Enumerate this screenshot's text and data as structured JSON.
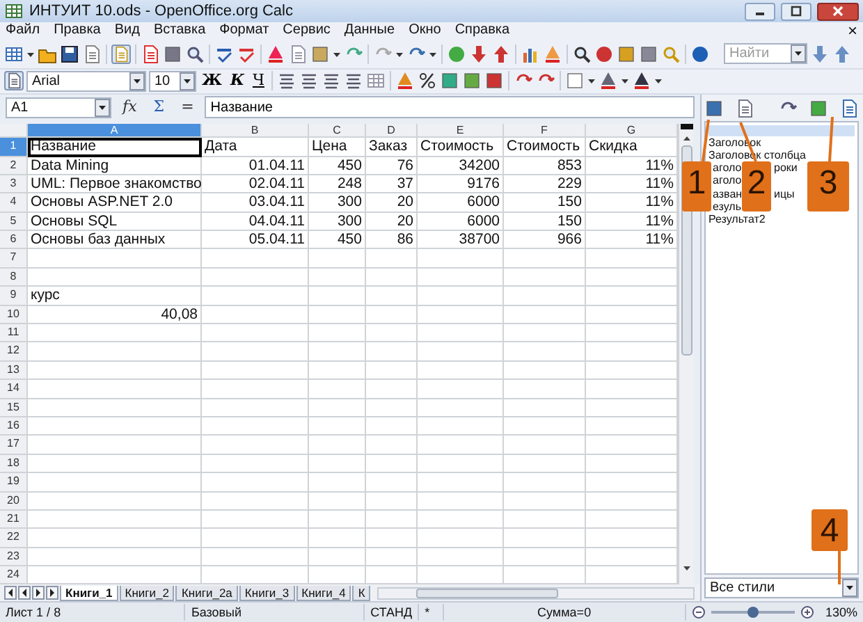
{
  "window": {
    "title": "ИНТУИТ 10.ods - OpenOffice.org Calc"
  },
  "menu": {
    "items": [
      "Файл",
      "Правка",
      "Вид",
      "Вставка",
      "Формат",
      "Сервис",
      "Данные",
      "Окно",
      "Справка"
    ],
    "close": "×"
  },
  "search": {
    "placeholder": "Найти"
  },
  "font": {
    "name": "Arial",
    "size": "10"
  },
  "format_buttons": [
    "Ж",
    "К",
    "Ч"
  ],
  "formula_bar": {
    "cell": "A1",
    "buttons": [
      "fx",
      "Σ",
      "="
    ],
    "content": "Название"
  },
  "columns": [
    {
      "label": "A",
      "selected": true
    },
    {
      "label": "B",
      "selected": false
    },
    {
      "label": "C",
      "selected": false
    },
    {
      "label": "D",
      "selected": false
    },
    {
      "label": "E",
      "selected": false
    },
    {
      "label": "F",
      "selected": false
    },
    {
      "label": "G",
      "selected": false
    }
  ],
  "rows": [
    {
      "number": "1",
      "selected": true,
      "kind": "header",
      "cells": [
        "Название",
        "Дата",
        "Цена",
        "Заказ",
        "Стоимость",
        "Стоимость",
        "Скидка"
      ]
    },
    {
      "number": "2",
      "selected": false,
      "kind": "data",
      "cells": [
        "Data Mining",
        "01.04.11",
        "450",
        "76",
        "34200",
        "853",
        "11%"
      ]
    },
    {
      "number": "3",
      "selected": false,
      "kind": "data",
      "cells": [
        "UML: Первое знакомство",
        "02.04.11",
        "248",
        "37",
        "9176",
        "229",
        "11%"
      ]
    },
    {
      "number": "4",
      "selected": false,
      "kind": "data",
      "cells": [
        "Основы ASP.NET 2.0",
        "03.04.11",
        "300",
        "20",
        "6000",
        "150",
        "11%"
      ]
    },
    {
      "number": "5",
      "selected": false,
      "kind": "data",
      "cells": [
        "Основы SQL",
        "04.04.11",
        "300",
        "20",
        "6000",
        "150",
        "11%"
      ]
    },
    {
      "number": "6",
      "selected": false,
      "kind": "data",
      "cells": [
        "Основы баз данных",
        "05.04.11",
        "450",
        "86",
        "38700",
        "966",
        "11%"
      ]
    },
    {
      "number": "7",
      "selected": false,
      "kind": "empty"
    },
    {
      "number": "8",
      "selected": false,
      "kind": "empty"
    },
    {
      "number": "9",
      "selected": false,
      "kind": "label",
      "cells": [
        "курс"
      ]
    },
    {
      "number": "10",
      "selected": false,
      "kind": "value",
      "cells": [
        "40,08"
      ]
    },
    {
      "number": "11",
      "selected": false,
      "kind": "empty"
    },
    {
      "number": "12",
      "selected": false,
      "kind": "empty"
    },
    {
      "number": "13",
      "selected": false,
      "kind": "empty"
    },
    {
      "number": "14",
      "selected": false,
      "kind": "empty"
    },
    {
      "number": "15",
      "selected": false,
      "kind": "empty"
    },
    {
      "number": "16",
      "selected": false,
      "kind": "empty"
    },
    {
      "number": "17",
      "selected": false,
      "kind": "empty"
    },
    {
      "number": "18",
      "selected": false,
      "kind": "empty"
    },
    {
      "number": "19",
      "selected": false,
      "kind": "empty"
    },
    {
      "number": "20",
      "selected": false,
      "kind": "empty"
    },
    {
      "number": "21",
      "selected": false,
      "kind": "empty"
    },
    {
      "number": "22",
      "selected": false,
      "kind": "empty"
    },
    {
      "number": "23",
      "selected": false,
      "kind": "empty"
    },
    {
      "number": "24",
      "selected": false,
      "kind": "empty"
    }
  ],
  "sheet_tabs": [
    {
      "label": "Книги_1",
      "selected": true
    },
    {
      "label": "Книги_2",
      "selected": false
    },
    {
      "label": "Книги_2a",
      "selected": false
    },
    {
      "label": "Книги_3",
      "selected": false
    },
    {
      "label": "Книги_4",
      "selected": false
    },
    {
      "label": "К",
      "selected": false
    }
  ],
  "styles_panel": {
    "items": [
      {
        "kind": "plain",
        "parts": [
          "Заголовок"
        ]
      },
      {
        "kind": "plain",
        "parts": [
          "Заголовок столбца"
        ]
      },
      {
        "kind": "fragment",
        "parts": [
          "аголо",
          "роки"
        ]
      },
      {
        "kind": "fragment",
        "parts": [
          "аголо"
        ]
      },
      {
        "kind": "fragment",
        "parts": [
          "азван",
          "ицы"
        ]
      },
      {
        "kind": "fragment",
        "parts": [
          "езуль"
        ]
      },
      {
        "kind": "plain",
        "parts": [
          "Результат2"
        ]
      }
    ],
    "filter": "Все стили"
  },
  "status_bar": {
    "sheet": "Лист 1 / 8",
    "style": "Базовый",
    "mode": "СТАНД",
    "modified": "*",
    "sum": "Сумма=0",
    "zoom_slider": {
      "level": 0.5
    },
    "zoom": "130%"
  },
  "callouts": [
    "1",
    "2",
    "3",
    "4"
  ]
}
